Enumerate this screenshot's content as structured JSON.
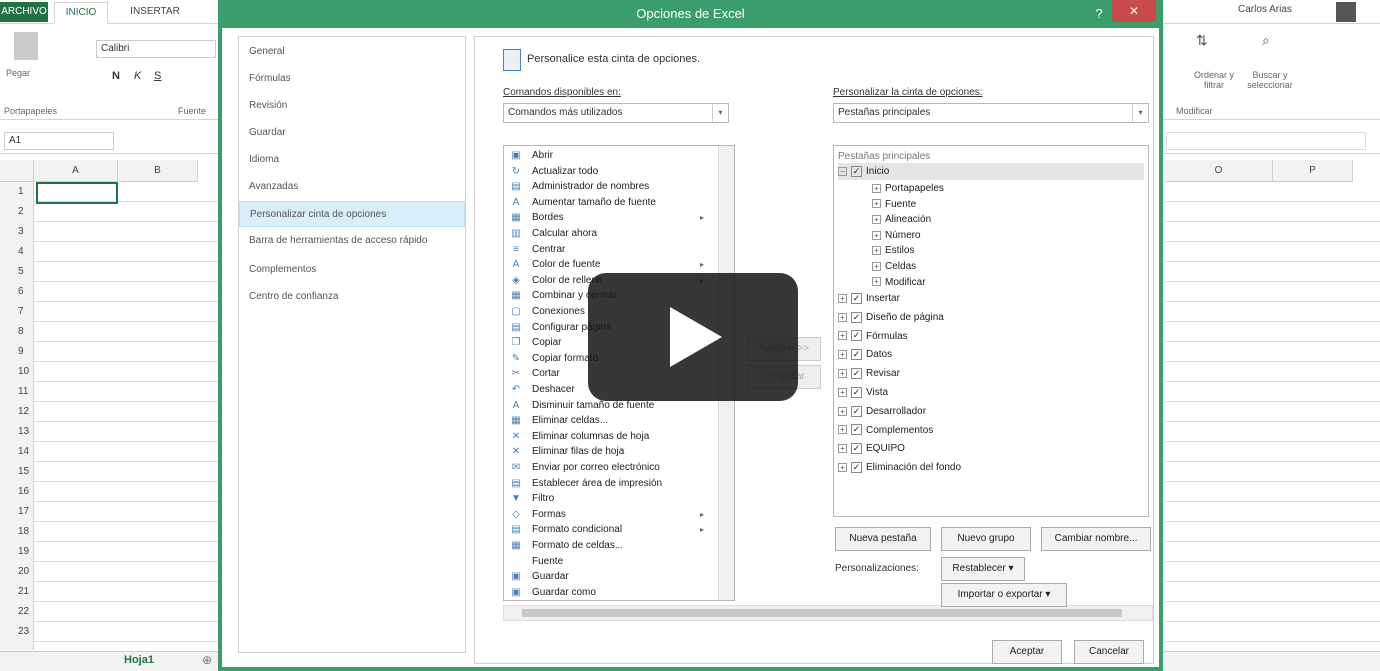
{
  "excel": {
    "tabs": [
      "ARCHIVO",
      "INICIO",
      "INSERTAR"
    ],
    "user": "Carlos Arias",
    "clipboard": {
      "paste": "Pegar",
      "group": "Portapapeles"
    },
    "font": {
      "name": "Calibri",
      "group": "Fuente",
      "bold": "N",
      "italic": "K",
      "underline": "S"
    },
    "edit": {
      "sort": "Ordenar y filtrar",
      "find": "Buscar y seleccionar",
      "group": "Modificar"
    },
    "name_box": "A1",
    "columns_left": [
      "A",
      "B"
    ],
    "columns_right": [
      "O",
      "P"
    ],
    "rows": [
      "1",
      "2",
      "3",
      "4",
      "5",
      "6",
      "7",
      "8",
      "9",
      "10",
      "11",
      "12",
      "13",
      "14",
      "15",
      "16",
      "17",
      "18",
      "19",
      "20",
      "21",
      "22",
      "23"
    ],
    "sheet": "Hoja1"
  },
  "dialog": {
    "title": "Opciones de Excel",
    "help": "?",
    "close": "✕",
    "nav": [
      "General",
      "Fórmulas",
      "Revisión",
      "Guardar",
      "Idioma",
      "Avanzadas",
      "Personalizar cinta de opciones",
      "Barra de herramientas de acceso rápido",
      "Complementos",
      "Centro de confianza"
    ],
    "selected_nav_index": 6,
    "header": "Personalice esta cinta de opciones.",
    "commands_label": "Comandos disponibles en:",
    "commands_value": "Comandos más utilizados",
    "ribbon_label": "Personalizar la cinta de opciones:",
    "ribbon_value": "Pestañas principales",
    "commands": [
      "Abrir",
      "Actualizar todo",
      "Administrador de nombres",
      "Aumentar tamaño de fuente",
      "Bordes",
      "Calcular ahora",
      "Centrar",
      "Color de fuente",
      "Color de relleno",
      "Combinar y centrar",
      "Conexiones",
      "Configurar página",
      "Copiar",
      "Copiar formato",
      "Cortar",
      "Deshacer",
      "Disminuir tamaño de fuente",
      "Eliminar celdas...",
      "Eliminar columnas de hoja",
      "Eliminar filas de hoja",
      "Enviar por correo electrónico",
      "Establecer área de impresión",
      "Filtro",
      "Formas",
      "Formato condicional",
      "Formato de celdas...",
      "Fuente",
      "Guardar",
      "Guardar como"
    ],
    "add_button": "Agregar >>",
    "remove_button": "<< Quitar",
    "tree_header": "Pestañas principales",
    "tree_root": "Inicio",
    "tree_children": [
      "Portapapeles",
      "Fuente",
      "Alineación",
      "Número",
      "Estilos",
      "Celdas",
      "Modificar"
    ],
    "tree_tabs": [
      "Insertar",
      "Diseño de página",
      "Fórmulas",
      "Datos",
      "Revisar",
      "Vista",
      "Desarrollador",
      "Complementos",
      "EQUIPO",
      "Eliminación del fondo"
    ],
    "new_tab": "Nueva pestaña",
    "new_group": "Nuevo grupo",
    "rename": "Cambiar nombre...",
    "customizations_label": "Personalizaciones:",
    "reset": "Restablecer ▾",
    "import_export": "Importar o exportar ▾",
    "ok": "Aceptar",
    "cancel": "Cancelar"
  },
  "video": {
    "play_icon": "play-icon"
  }
}
